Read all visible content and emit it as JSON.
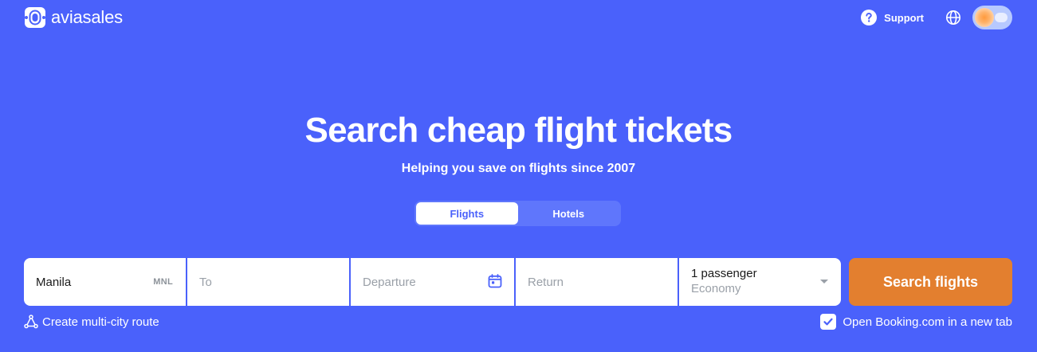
{
  "header": {
    "brand": "aviasales",
    "support_label": "Support",
    "icons": {
      "logo": "aviasales-logo-icon",
      "support": "question-icon",
      "language": "globe-icon",
      "theme": "theme-toggle"
    }
  },
  "hero": {
    "title": "Search cheap flight tickets",
    "subtitle": "Helping you save on flights since 2007"
  },
  "tabs": [
    {
      "label": "Flights",
      "active": true
    },
    {
      "label": "Hotels",
      "active": false
    }
  ],
  "search": {
    "origin": {
      "value": "Manila",
      "code": "MNL"
    },
    "destination": {
      "placeholder": "To"
    },
    "departure": {
      "placeholder": "Departure"
    },
    "return": {
      "placeholder": "Return"
    },
    "passengers": {
      "count_label": "1 passenger",
      "class_label": "Economy"
    },
    "submit_label": "Search flights"
  },
  "footer": {
    "multi_city_label": "Create multi-city route",
    "booking_label": "Open Booking.com in a new tab",
    "booking_checked": true
  },
  "colors": {
    "background": "#4a61fb",
    "accent": "#e37f2f",
    "white": "#ffffff"
  }
}
